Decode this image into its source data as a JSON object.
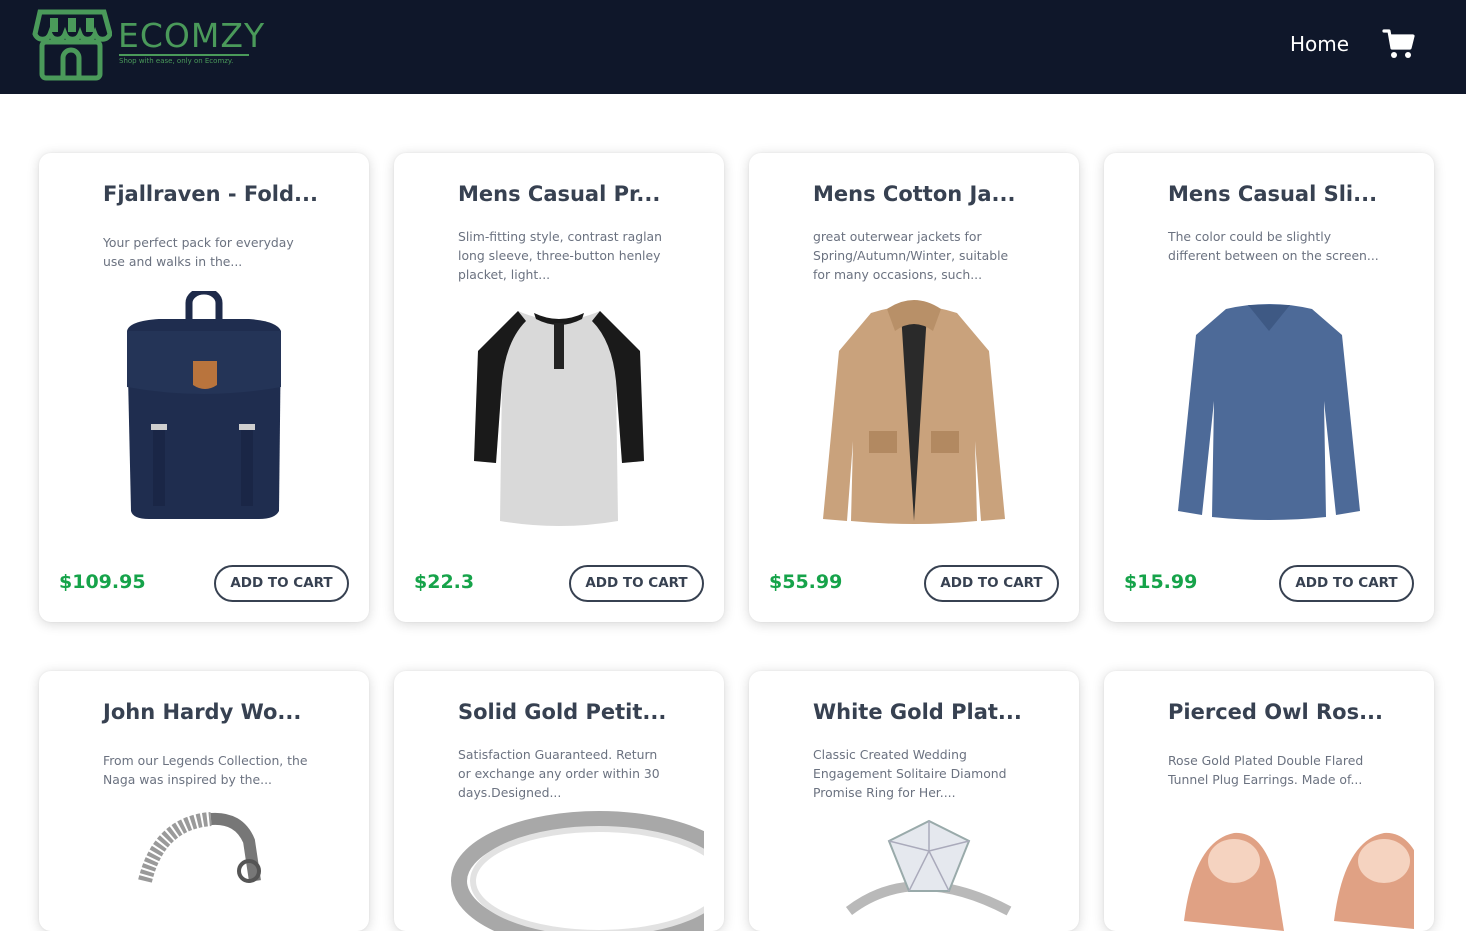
{
  "navbar": {
    "logo_text": "ECOMZY",
    "logo_tagline": "Shop with ease, only on Ecomzy.",
    "home_label": "Home",
    "cart_icon": "cart-icon",
    "bg_color": "#0f172a",
    "brand_color": "#4a9a5a"
  },
  "products": [
    {
      "title": "Fjallraven - Fold...",
      "description": "Your perfect pack for everyday use and walks in the...",
      "price": "$109.95",
      "button_label": "ADD TO CART",
      "image": "backpack-image"
    },
    {
      "title": "Mens Casual Pr...",
      "description": "Slim-fitting style, contrast raglan long sleeve, three-button henley placket, light...",
      "price": "$22.3",
      "button_label": "ADD TO CART",
      "image": "raglan-shirt-image"
    },
    {
      "title": "Mens Cotton Ja...",
      "description": "great outerwear jackets for Spring/Autumn/Winter, suitable for many occasions, such...",
      "price": "$55.99",
      "button_label": "ADD TO CART",
      "image": "jacket-image"
    },
    {
      "title": "Mens Casual Sli...",
      "description": "The color could be slightly different between on the screen...",
      "price": "$15.99",
      "button_label": "ADD TO CART",
      "image": "long-sleeve-shirt-image"
    },
    {
      "title": "John Hardy Wo...",
      "description": "From our Legends Collection, the Naga was inspired by the...",
      "image": "bracelet-image"
    },
    {
      "title": "Solid Gold Petit...",
      "description": "Satisfaction Guaranteed. Return or exchange any order within 30 days.Designed...",
      "image": "silver-ring-image"
    },
    {
      "title": "White Gold Plat...",
      "description": "Classic Created Wedding Engagement Solitaire Diamond Promise Ring for Her....",
      "image": "diamond-ring-image"
    },
    {
      "title": "Pierced Owl Ros...",
      "description": "Rose Gold Plated Double Flared Tunnel Plug Earrings. Made of...",
      "image": "rose-gold-plugs-image"
    }
  ],
  "price_color": "#16a34a"
}
